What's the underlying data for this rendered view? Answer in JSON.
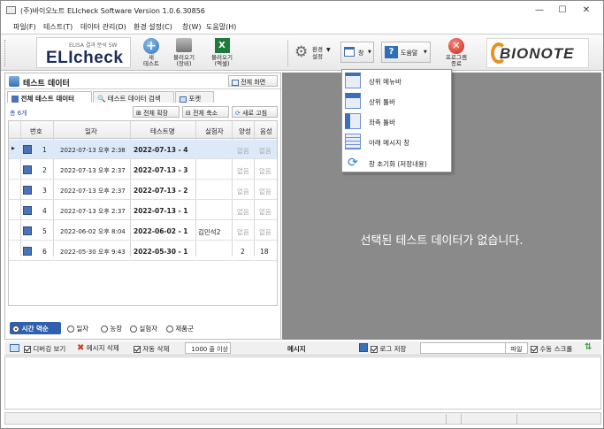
{
  "window": {
    "title": "(주)바이오노트 ELIcheck Software Version 1.0.6.30856",
    "minimize": "—",
    "maximize": "☐",
    "close": "✕"
  },
  "menu": [
    "파일(F)",
    "테스트(T)",
    "데이터 관리(D)",
    "환경 설정(C)",
    "창(W)",
    "도움말(H)"
  ],
  "toolbar": {
    "logo_sub": "ELISA 결과 분석 SW",
    "logo_main": "ELIcheck",
    "new_test": [
      "새",
      "테스트"
    ],
    "load_device": [
      "불러오기",
      "(장비)"
    ],
    "load_excel": [
      "불러오기",
      "(엑셀)"
    ],
    "settings": [
      "환경",
      "설정"
    ],
    "window_btn": "창",
    "help_btn": "도움말",
    "exit": [
      "프로그램",
      "종료"
    ],
    "brand": "BIONOTE"
  },
  "left_panel": {
    "title": "테스트 데이터",
    "fullscreen": "전체 화면",
    "tabs": [
      "전체 테스트 데이터",
      "테스트 데이터 검색",
      "포켓"
    ],
    "count": "총 6개",
    "expand_all": "전체 확장",
    "collapse_all": "전체 축소",
    "refresh": "새로 고침",
    "columns": [
      "번호",
      "일자",
      "테스트명",
      "실험자",
      "양성",
      "음성"
    ],
    "rows": [
      {
        "no": "1",
        "date": "2022-07-13 오후 2:38",
        "name": "2022-07-13 - 4",
        "user": "",
        "pos": "없음",
        "neg": "없음"
      },
      {
        "no": "2",
        "date": "2022-07-13 오후 2:37",
        "name": "2022-07-13 - 3",
        "user": "",
        "pos": "없음",
        "neg": "없음"
      },
      {
        "no": "3",
        "date": "2022-07-13 오후 2:37",
        "name": "2022-07-13 - 2",
        "user": "",
        "pos": "없음",
        "neg": "없음"
      },
      {
        "no": "4",
        "date": "2022-07-13 오후 2:37",
        "name": "2022-07-13 - 1",
        "user": "",
        "pos": "없음",
        "neg": "없음"
      },
      {
        "no": "5",
        "date": "2022-06-02 오후 8:04",
        "name": "2022-06-02 - 1",
        "user": "김민석2",
        "pos": "없음",
        "neg": "없음"
      },
      {
        "no": "6",
        "date": "2022-05-30 오후 9:43",
        "name": "2022-05-30 - 1",
        "user": "",
        "pos": "2",
        "neg": "18"
      }
    ],
    "sort_options": [
      "시간 역순",
      "일자",
      "농장",
      "실험자",
      "제품군"
    ]
  },
  "right_panel": {
    "empty_message": "선택된 테스트 데이터가 없습니다."
  },
  "bottom": {
    "debug_view": "디버깅 보기",
    "delete_msg": "메시지 삭제",
    "auto_delete": "자동 삭제",
    "limit": "1000 줄 이상",
    "message": "메시지",
    "log_save": "로그 저장",
    "file": "파일",
    "manual_scroll": "수동 스크롤"
  },
  "window_menu": {
    "items": [
      "상위 메뉴바",
      "상위 툴바",
      "좌측 툴바",
      "아래 메시지 창",
      "창 초기화 (저장내용)"
    ]
  }
}
